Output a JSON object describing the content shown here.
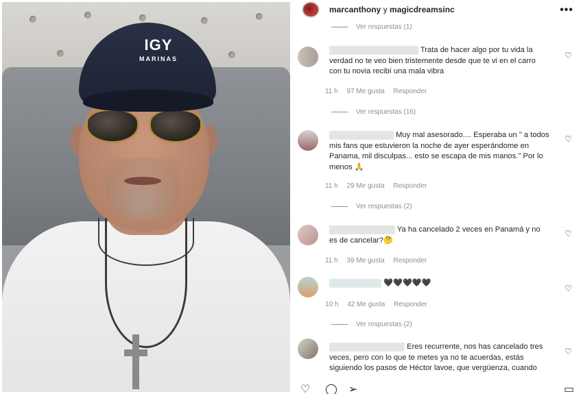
{
  "cap_logo": {
    "line1": "IGY",
    "line2": "MARINAS"
  },
  "header": {
    "account1": "marcanthony",
    "connector": "y",
    "account2": "magicdreamsinc",
    "more": "•••"
  },
  "top_view_replies": "Ver respuestas (1)",
  "comments": [
    {
      "text": "Trata de hacer algo por tu vida la verdad no te veo bien tristemente desde que te vi en el carro con tu novia recibí una mala vibra",
      "time": "11 h",
      "likes": "97 Me gusta",
      "reply": "Responder",
      "view_replies": "Ver respuestas (16)"
    },
    {
      "text": "Muy mal asesorado.... Esperaba un \" a todos mis fans que estuvieron la noche de ayer esperándome en Panama, mil disculpas... esto se escapa de mis manos.\" Por lo menos 🙏",
      "time": "11 h",
      "likes": "29 Me gusta",
      "reply": "Responder",
      "view_replies": "Ver respuestas (2)"
    },
    {
      "text": "Ya ha cancelado 2 veces en Panamá y no es de cancelar?🤔",
      "time": "11 h",
      "likes": "39 Me gusta",
      "reply": "Responder"
    },
    {
      "text": "🖤🖤🖤🖤🖤",
      "time": "10 h",
      "likes": "42 Me gusta",
      "reply": "Responder",
      "view_replies": "Ver respuestas (2)"
    },
    {
      "text": "Eres recurrente, nos has cancelado tres veces, pero con lo que te metes ya no te acuerdas, estás siguiendo los pasos de Héctor lavoe, que vergüenza, cuando"
    }
  ],
  "icons": {
    "like": "♡",
    "comment": "◯",
    "share": "➢",
    "save": "▭"
  }
}
